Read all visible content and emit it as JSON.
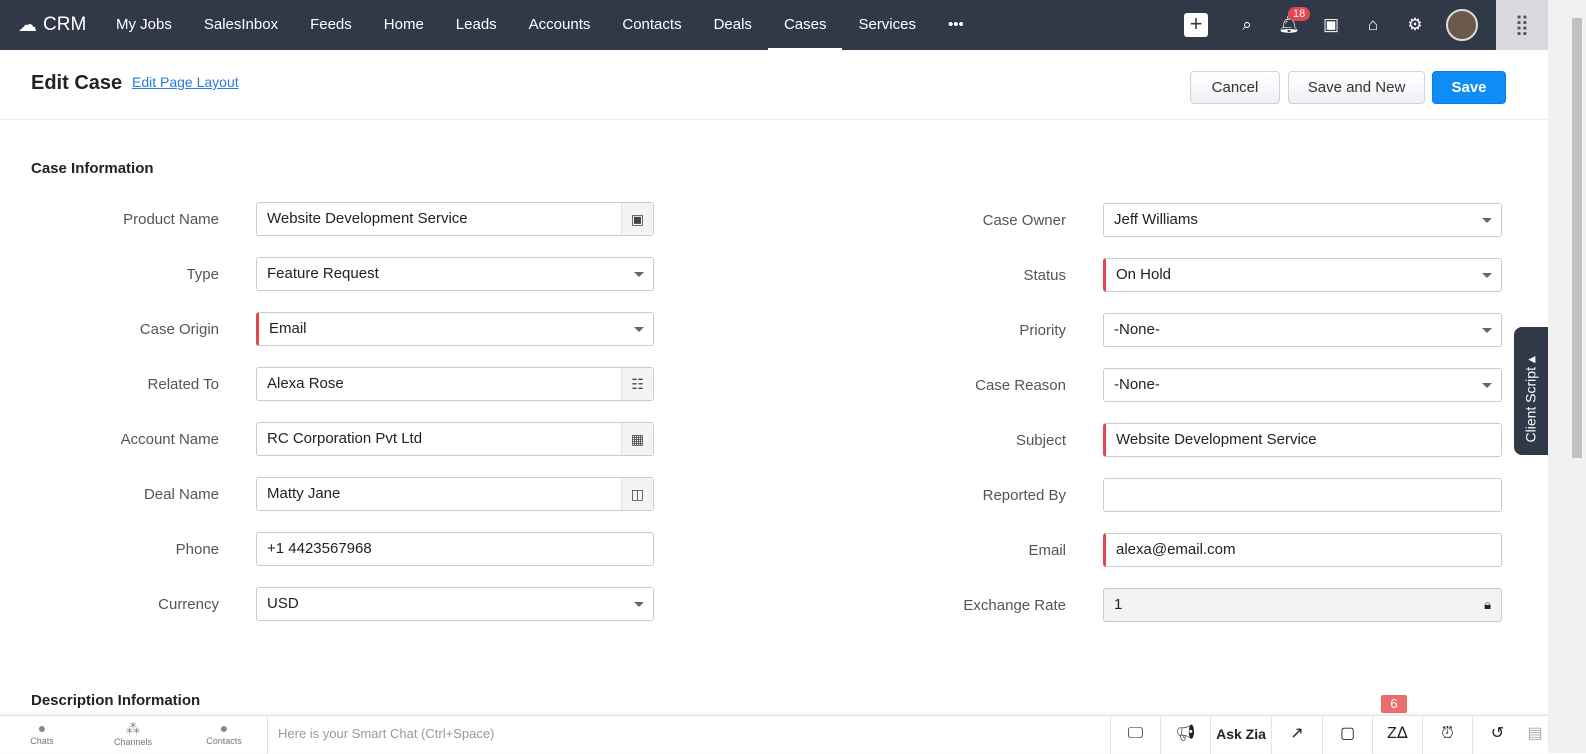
{
  "nav": {
    "brand": "CRM",
    "items": [
      "My Jobs",
      "SalesInbox",
      "Feeds",
      "Home",
      "Leads",
      "Accounts",
      "Contacts",
      "Deals",
      "Cases",
      "Services",
      "•••"
    ],
    "active": "Cases",
    "notifications": "18"
  },
  "header": {
    "title": "Edit Case",
    "edit_layout": "Edit Page Layout",
    "cancel": "Cancel",
    "save_new": "Save and New",
    "save": "Save"
  },
  "sections": {
    "case_info": "Case Information",
    "description": "Description Information"
  },
  "left_fields": [
    {
      "label": "Product Name",
      "value": "Website Development Service",
      "kind": "lookup",
      "icon": "product-icon",
      "glyph": "▣"
    },
    {
      "label": "Type",
      "value": "Feature Request",
      "kind": "select"
    },
    {
      "label": "Case Origin",
      "value": "Email",
      "kind": "select",
      "required": true
    },
    {
      "label": "Related To",
      "value": "Alexa Rose",
      "kind": "lookup",
      "icon": "contact-card-icon",
      "glyph": "☷"
    },
    {
      "label": "Account Name",
      "value": "RC Corporation Pvt Ltd",
      "kind": "lookup",
      "icon": "building-icon",
      "glyph": "▦"
    },
    {
      "label": "Deal Name",
      "value": "Matty Jane",
      "kind": "lookup",
      "icon": "wallet-icon",
      "glyph": "◫"
    },
    {
      "label": "Phone",
      "value": "+1 4423567968",
      "kind": "text"
    },
    {
      "label": "Currency",
      "value": "USD",
      "kind": "select"
    }
  ],
  "right_fields": [
    {
      "label": "Case Owner",
      "value": "Jeff Williams",
      "kind": "select"
    },
    {
      "label": "Status",
      "value": "On Hold",
      "kind": "select",
      "required": true
    },
    {
      "label": "Priority",
      "value": "-None-",
      "kind": "select"
    },
    {
      "label": "Case Reason",
      "value": "-None-",
      "kind": "select"
    },
    {
      "label": "Subject",
      "value": "Website Development Service",
      "kind": "text",
      "required": true
    },
    {
      "label": "Reported By",
      "value": "",
      "kind": "text"
    },
    {
      "label": "Email",
      "value": "alexa@email.com",
      "kind": "text",
      "required": true
    },
    {
      "label": "Exchange Rate",
      "value": "1",
      "kind": "readonly"
    }
  ],
  "client_script": "Client Script ▴",
  "bottom": {
    "chats": "Chats",
    "channels": "Channels",
    "contacts": "Contacts",
    "smart_chat_placeholder": "Here is your Smart Chat (Ctrl+Space)",
    "ask_zia": "Ask Zia",
    "zia_badge": "6"
  }
}
